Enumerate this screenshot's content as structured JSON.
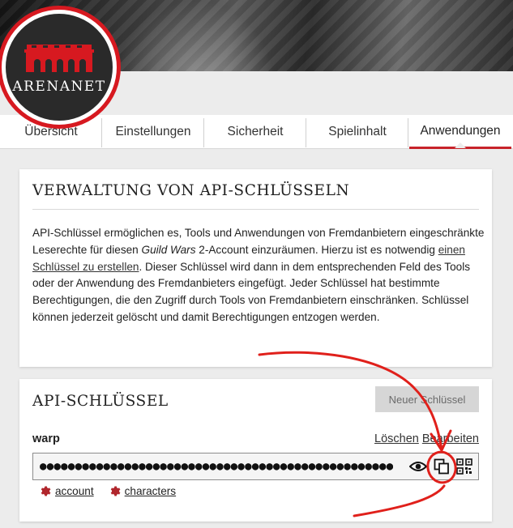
{
  "brand": {
    "name": "ArenaNet",
    "logo_text": "ARENANET",
    "accent": "#d71920"
  },
  "tabs": [
    {
      "label": "Übersicht",
      "active": false
    },
    {
      "label": "Einstellungen",
      "active": false
    },
    {
      "label": "Sicherheit",
      "active": false
    },
    {
      "label": "Spielinhalt",
      "active": false
    },
    {
      "label": "Anwendungen",
      "active": true
    }
  ],
  "management": {
    "title": "VERWALTUNG VON API-SCHLÜSSELN",
    "description": {
      "p1": "API-Schlüssel ermöglichen es, Tools und Anwendungen von Fremdanbietern eingeschränkte Leserechte für diesen ",
      "game_title": "Guild Wars",
      "p2": " 2-Account einzuräumen. Hierzu ist es notwendig ",
      "link_text": "einen Schlüssel zu erstellen",
      "p3": ". Dieser Schlüssel wird dann in dem entsprechenden Feld des Tools oder der Anwendung des Fremdanbieters eingefügt. Jeder Schlüssel hat bestimmte Berechtigungen, die den Zugriff durch Tools von Fremdanbietern einschränken. Schlüssel können jederzeit gelöscht und damit Berechtigungen entzogen werden."
    }
  },
  "api_keys": {
    "title": "API-SCHLÜSSEL",
    "new_key_label": "Neuer Schlüssel",
    "keys": [
      {
        "name": "warp",
        "delete_label": "Löschen",
        "edit_label": "Bearbeiten",
        "masked_value": "●●●●●●●●●●●●●●●●●●●●●●●●●●●●●●●●●●●●●●●●●●●●●●●●●●●●●●●●●●●●●",
        "icons": [
          "eye-icon",
          "copy-icon",
          "qr-code-icon"
        ],
        "permissions": [
          {
            "icon": "gear-icon",
            "label": "account"
          },
          {
            "icon": "gear-icon",
            "label": "characters"
          }
        ]
      }
    ]
  },
  "annotation": {
    "color": "#e0201b",
    "description": "hand-drawn red arrow pointing to circled copy icon"
  }
}
